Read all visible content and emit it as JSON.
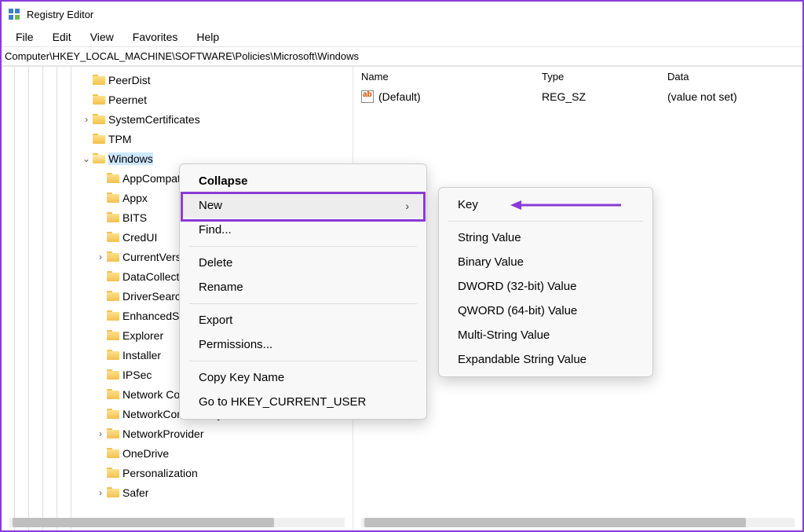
{
  "titlebar": {
    "title": "Registry Editor"
  },
  "menubar": {
    "items": [
      "File",
      "Edit",
      "View",
      "Favorites",
      "Help"
    ]
  },
  "addressbar": {
    "path": "Computer\\HKEY_LOCAL_MACHINE\\SOFTWARE\\Policies\\Microsoft\\Windows"
  },
  "tree": {
    "items": [
      {
        "indent": 5,
        "expander": "",
        "label": "PeerDist"
      },
      {
        "indent": 5,
        "expander": "",
        "label": "Peernet"
      },
      {
        "indent": 5,
        "expander": ">",
        "label": "SystemCertificates"
      },
      {
        "indent": 5,
        "expander": "",
        "label": "TPM"
      },
      {
        "indent": 5,
        "expander": "v",
        "label": "Windows",
        "selected": true,
        "open": true
      },
      {
        "indent": 6,
        "expander": "",
        "label": "AppCompat"
      },
      {
        "indent": 6,
        "expander": "",
        "label": "Appx"
      },
      {
        "indent": 6,
        "expander": "",
        "label": "BITS"
      },
      {
        "indent": 6,
        "expander": "",
        "label": "CredUI"
      },
      {
        "indent": 6,
        "expander": ">",
        "label": "CurrentVersion"
      },
      {
        "indent": 6,
        "expander": "",
        "label": "DataCollection"
      },
      {
        "indent": 6,
        "expander": "",
        "label": "DriverSearching"
      },
      {
        "indent": 6,
        "expander": "",
        "label": "EnhancedStorageDevices"
      },
      {
        "indent": 6,
        "expander": "",
        "label": "Explorer"
      },
      {
        "indent": 6,
        "expander": "",
        "label": "Installer"
      },
      {
        "indent": 6,
        "expander": "",
        "label": "IPSec"
      },
      {
        "indent": 6,
        "expander": "",
        "label": "Network Connections"
      },
      {
        "indent": 6,
        "expander": "",
        "label": "NetworkConnectivityStatusIndicator"
      },
      {
        "indent": 6,
        "expander": ">",
        "label": "NetworkProvider"
      },
      {
        "indent": 6,
        "expander": "",
        "label": "OneDrive"
      },
      {
        "indent": 6,
        "expander": "",
        "label": "Personalization"
      },
      {
        "indent": 6,
        "expander": ">",
        "label": "Safer"
      }
    ]
  },
  "list": {
    "headers": {
      "name": "Name",
      "type": "Type",
      "data": "Data"
    },
    "rows": [
      {
        "name": "(Default)",
        "type": "REG_SZ",
        "data": "(value not set)"
      }
    ]
  },
  "context_menu": {
    "items": [
      {
        "label": "Collapse",
        "bold": true
      },
      {
        "label": "New",
        "hover": true,
        "submenu": true
      },
      {
        "label": "Find..."
      },
      {
        "sep": true
      },
      {
        "label": "Delete"
      },
      {
        "label": "Rename"
      },
      {
        "sep": true
      },
      {
        "label": "Export"
      },
      {
        "label": "Permissions..."
      },
      {
        "sep": true
      },
      {
        "label": "Copy Key Name"
      },
      {
        "label": "Go to HKEY_CURRENT_USER"
      }
    ]
  },
  "submenu": {
    "items": [
      {
        "label": "Key",
        "highlighted": true
      },
      {
        "sep": true
      },
      {
        "label": "String Value"
      },
      {
        "label": "Binary Value"
      },
      {
        "label": "DWORD (32-bit) Value"
      },
      {
        "label": "QWORD (64-bit) Value"
      },
      {
        "label": "Multi-String Value"
      },
      {
        "label": "Expandable String Value"
      }
    ]
  }
}
